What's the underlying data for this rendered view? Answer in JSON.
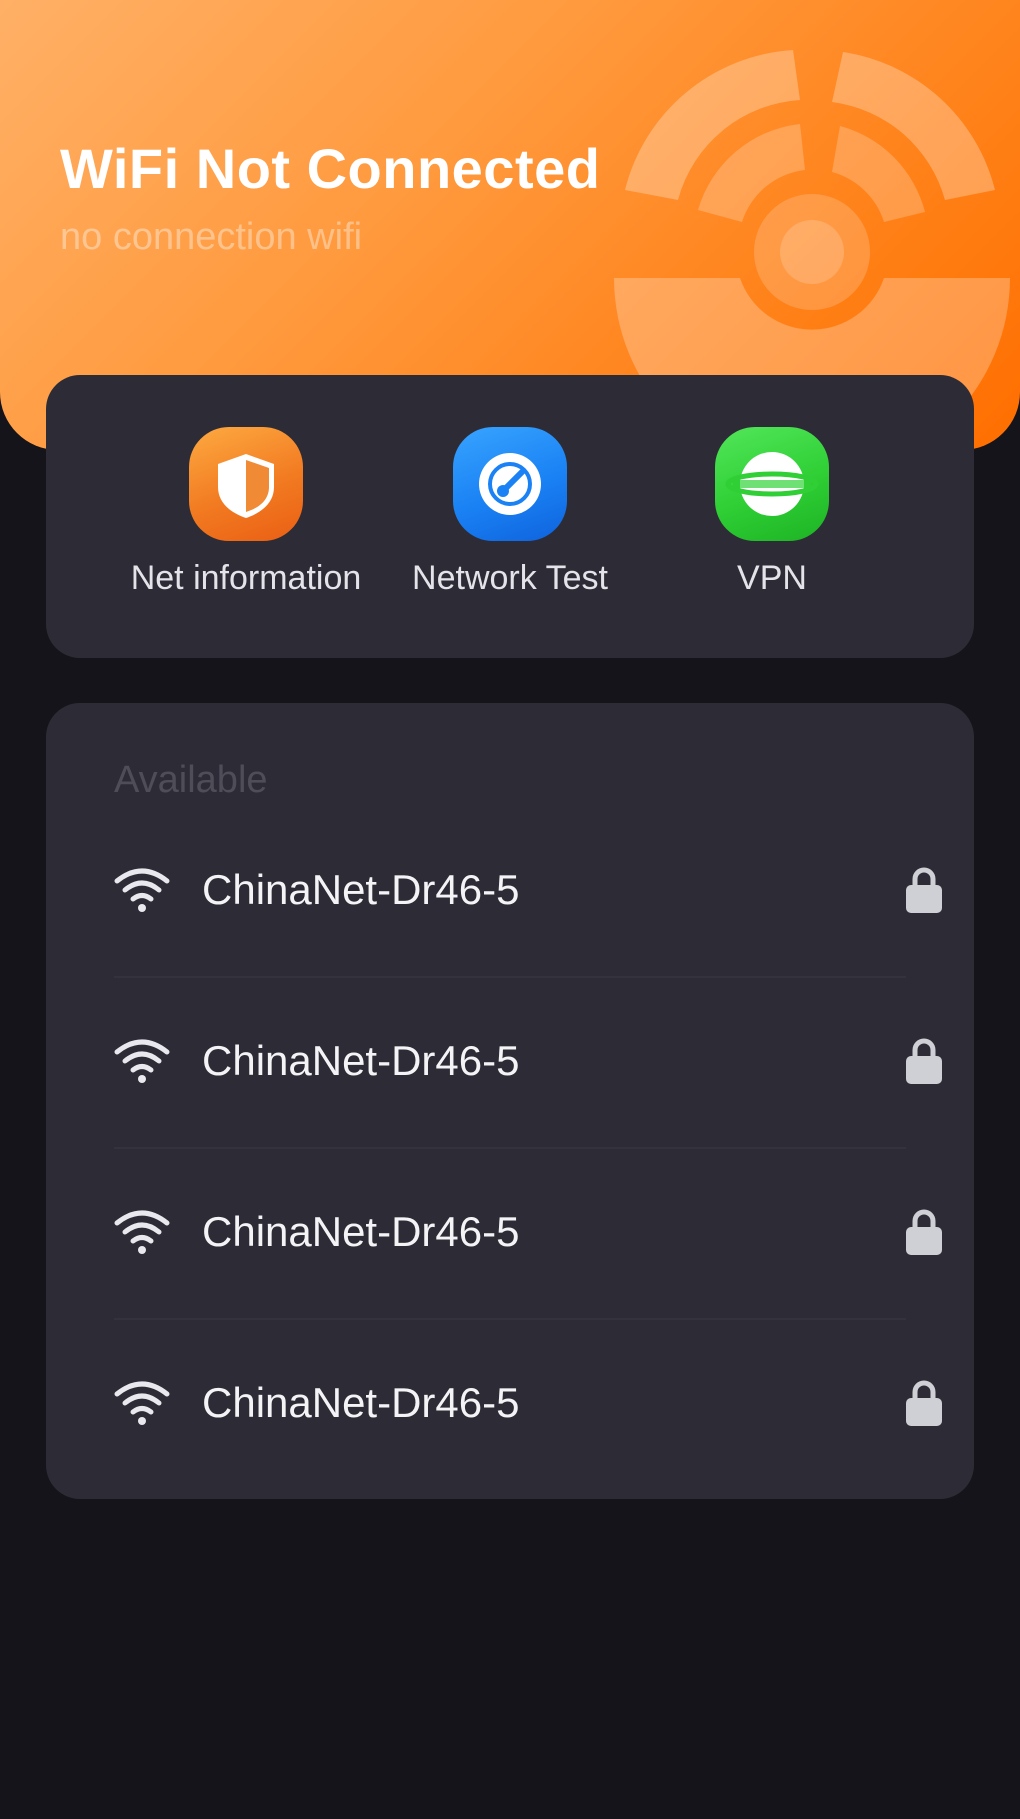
{
  "header": {
    "title": "WiFi Not Connected",
    "subtitle": "no connection wifi",
    "graphic_icon": "radar-signal-icon",
    "gradient": [
      "#ffb066",
      "#ff6e00"
    ]
  },
  "tools": [
    {
      "label": "Net information",
      "icon": "shield-icon",
      "color": "#f07a22"
    },
    {
      "label": "Network Test",
      "icon": "speed-test-icon",
      "color": "#1a82f4"
    },
    {
      "label": "VPN",
      "icon": "globe-icon",
      "color": "#2fcf35"
    }
  ],
  "networks": {
    "section_label": "Available",
    "items": [
      {
        "ssid": "ChinaNet-Dr46-5",
        "secured": true
      },
      {
        "ssid": "ChinaNet-Dr46-5",
        "secured": true
      },
      {
        "ssid": "ChinaNet-Dr46-5",
        "secured": true
      },
      {
        "ssid": "ChinaNet-Dr46-5",
        "secured": true
      }
    ]
  },
  "colors": {
    "background": "#15141a",
    "card": "#2d2c36",
    "accent": "#ff7d12"
  }
}
